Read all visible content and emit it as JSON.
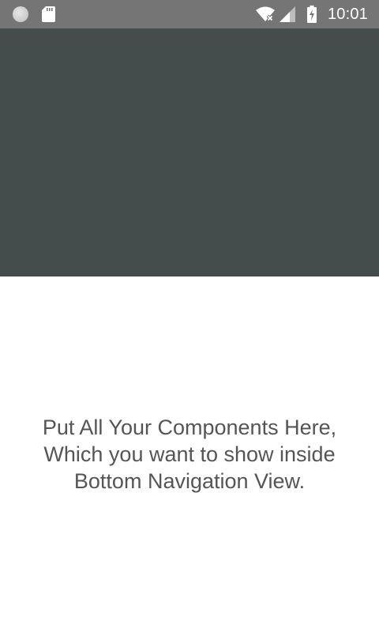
{
  "status_bar": {
    "time": "10:01",
    "icons": [
      "notification-circle-icon",
      "sd-card-icon",
      "wifi-off-icon",
      "cell-signal-icon",
      "battery-charging-icon"
    ],
    "background": "#757575"
  },
  "header_panel": {
    "background": "#454d4c"
  },
  "content": {
    "message": "Put All Your Components Here,\nWhich you want to show inside\nBottom Navigation View."
  }
}
